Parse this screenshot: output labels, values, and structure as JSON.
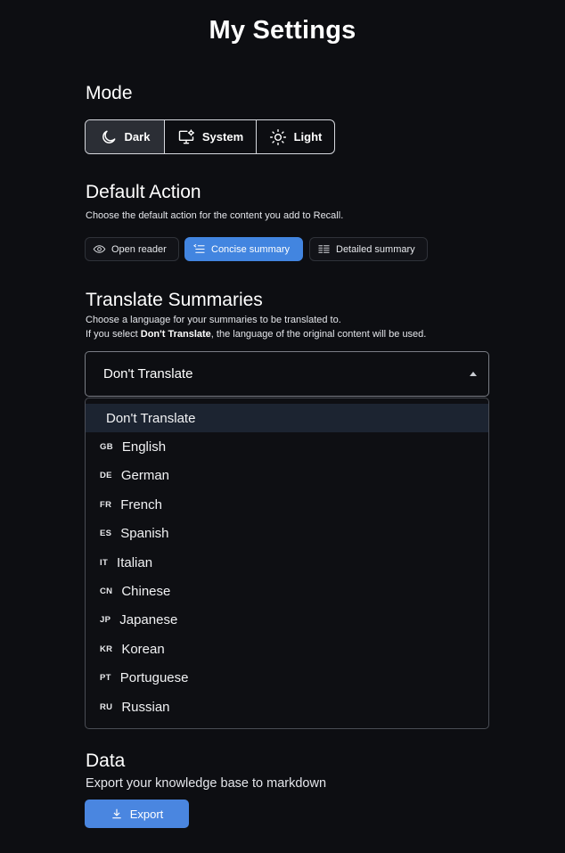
{
  "page": {
    "title": "My Settings"
  },
  "mode": {
    "title": "Mode",
    "options": [
      {
        "label": "Dark",
        "icon": "moon-icon",
        "active": true
      },
      {
        "label": "System",
        "icon": "monitor-gear-icon",
        "active": false
      },
      {
        "label": "Light",
        "icon": "sun-icon",
        "active": false
      }
    ]
  },
  "default_action": {
    "title": "Default Action",
    "description": "Choose the default action for the content you add to Recall.",
    "options": [
      {
        "label": "Open reader",
        "icon": "eye-icon",
        "active": false
      },
      {
        "label": "Concise summary",
        "icon": "concise-list-icon",
        "active": true
      },
      {
        "label": "Detailed summary",
        "icon": "detailed-list-icon",
        "active": false
      }
    ]
  },
  "translate": {
    "title": "Translate Summaries",
    "description_line1": "Choose a language for your summaries to be translated to.",
    "description_prefix": "If you select ",
    "description_bold": "Don't Translate",
    "description_suffix": ", the language of the original content will be used.",
    "selected_value": "Don't Translate",
    "options": [
      {
        "code": "",
        "label": "Don't Translate",
        "selected": true
      },
      {
        "code": "GB",
        "label": "English"
      },
      {
        "code": "DE",
        "label": "German"
      },
      {
        "code": "FR",
        "label": "French"
      },
      {
        "code": "ES",
        "label": "Spanish"
      },
      {
        "code": "IT",
        "label": "Italian"
      },
      {
        "code": "CN",
        "label": "Chinese"
      },
      {
        "code": "JP",
        "label": "Japanese"
      },
      {
        "code": "KR",
        "label": "Korean"
      },
      {
        "code": "PT",
        "label": "Portuguese"
      },
      {
        "code": "RU",
        "label": "Russian"
      }
    ]
  },
  "data_section": {
    "title": "Data",
    "description": "Export your knowledge base to markdown",
    "export_label": "Export",
    "export_icon": "download-icon"
  },
  "colors": {
    "background": "#0d0e12",
    "accent": "#4285e0",
    "selected_option": "#1c2431"
  }
}
